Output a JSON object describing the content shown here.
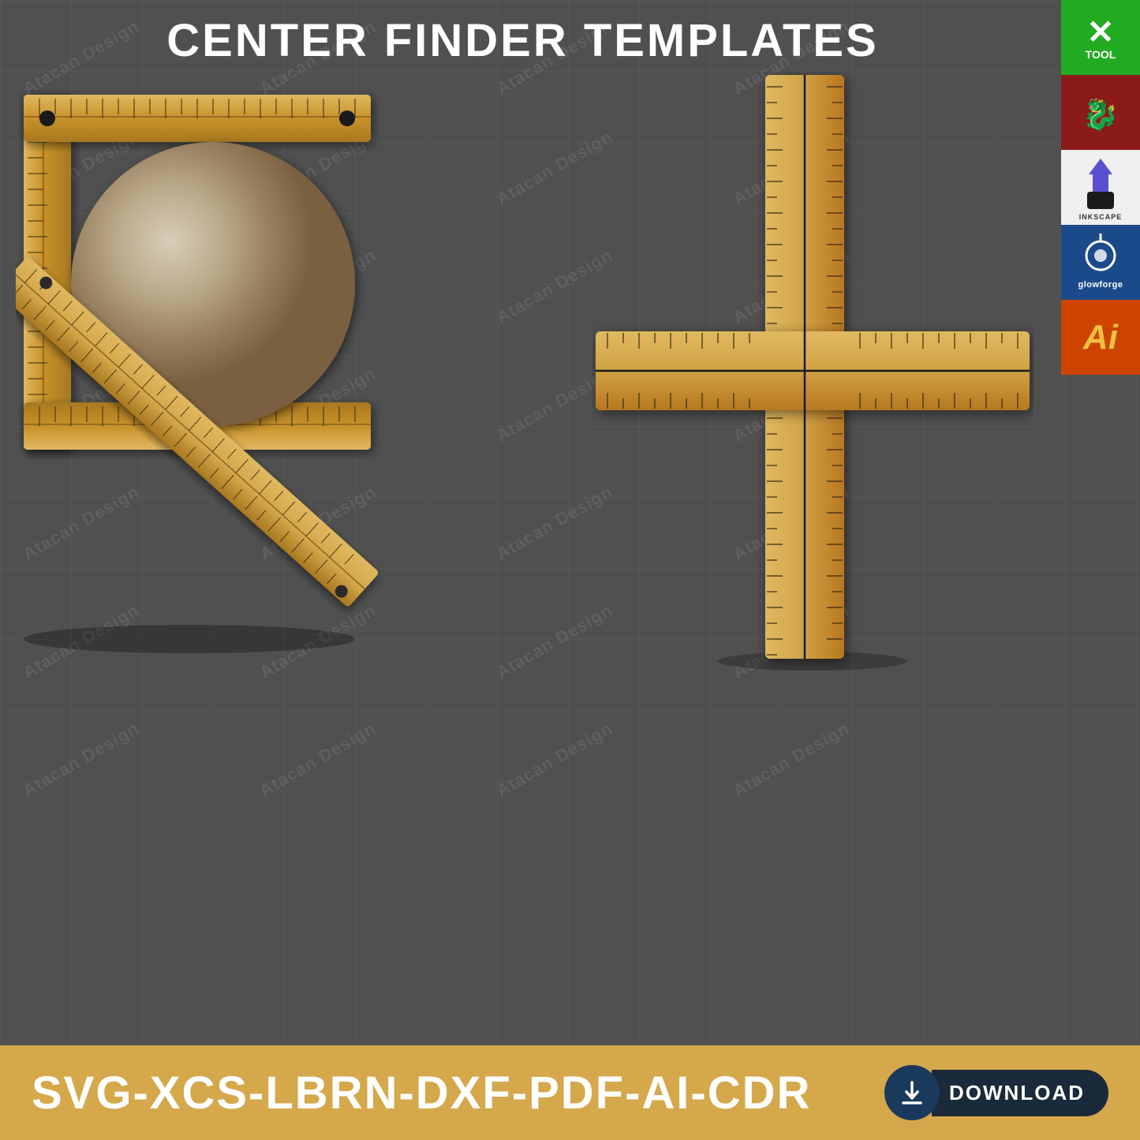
{
  "page": {
    "title": "CENTER FINDER TEMPLATES",
    "background_color": "#505050",
    "grid_color": "rgba(100,100,100,0.4)"
  },
  "sidebar": {
    "items": [
      {
        "id": "xtool",
        "label": "xTool",
        "x_label": "X",
        "tool_label": "TOOL",
        "bg_color": "#22aa22"
      },
      {
        "id": "dragon",
        "label": "Dragon",
        "bg_color": "#8b1a1a"
      },
      {
        "id": "inkscape",
        "label": "Inkscape",
        "text": "INKSCAPE",
        "bg_color": "#f0f0f0"
      },
      {
        "id": "glowforge",
        "label": "Glowforge",
        "text": "glowforge",
        "bg_color": "#1a4a8a"
      },
      {
        "id": "ai",
        "label": "Adobe Illustrator",
        "text": "Ai",
        "bg_color": "#cc4400"
      }
    ]
  },
  "bottom_bar": {
    "format_text": "SVG-XCS-LBRN-DXF-PDF-AI-CDR",
    "download_label": "DOWNLOAD",
    "bg_color": "#d4a84b"
  },
  "watermark": {
    "text": "Atacan Design",
    "color": "rgba(180,180,180,0.15)"
  },
  "tools": {
    "left": {
      "name": "Square Center Finder",
      "description": "Square frame with diagonal ruler and circle piece"
    },
    "right": {
      "name": "Cross Center Finder",
      "description": "Cross-shaped ruler with center lines"
    }
  }
}
